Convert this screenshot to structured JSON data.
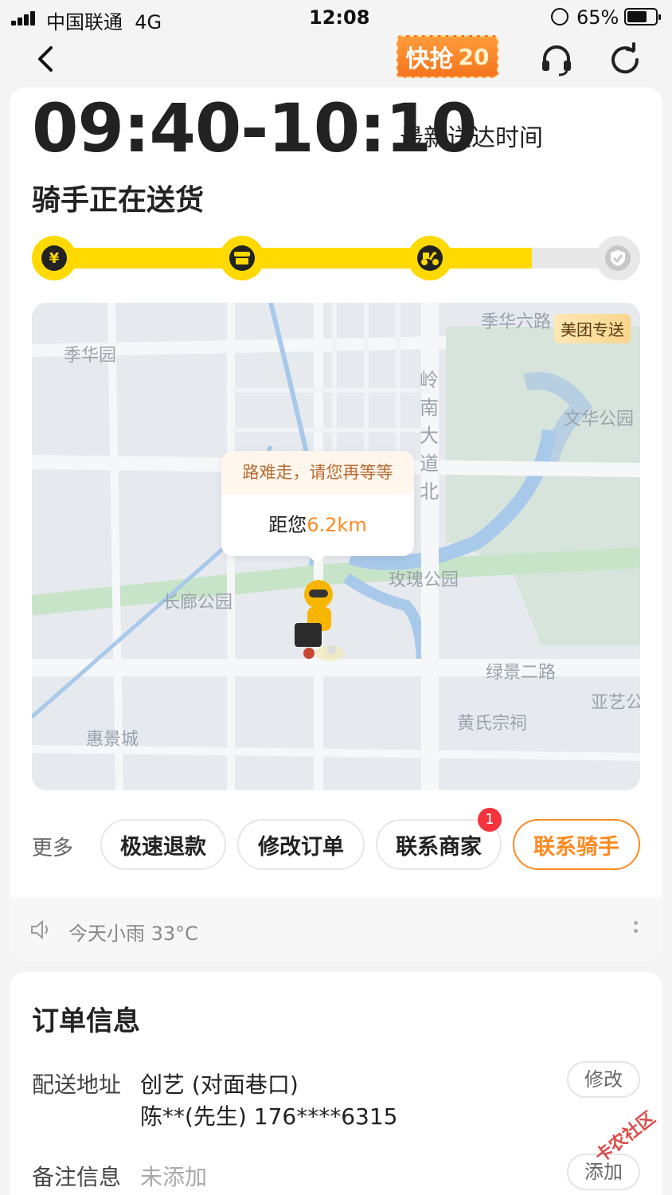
{
  "status_bar": {
    "carrier": "中国联通",
    "network": "4G",
    "time": "12:08",
    "battery_percent": "65%"
  },
  "navbar": {
    "promo_label": "快抢",
    "promo_number": "20",
    "icons": [
      "back-chevron-icon",
      "headset-icon",
      "refresh-icon"
    ]
  },
  "delivery": {
    "eta_range": "09:40-10:10",
    "eta_label": "最新送达时间",
    "status_title": "骑手正在送货",
    "progress": 0.84,
    "steps": [
      {
        "icon": "yuan-icon",
        "glyph": "¥"
      },
      {
        "icon": "store-icon",
        "glyph": ""
      },
      {
        "icon": "scooter-icon",
        "glyph": ""
      },
      {
        "icon": "shield-check-icon",
        "glyph": ""
      }
    ]
  },
  "map": {
    "badge": "美团专送",
    "bubble_message": "路难走，请您再等等",
    "distance_prefix": "距您",
    "distance_value": "6.2km",
    "labels": {
      "jihua_road": "季华六路",
      "jihua_park": "季华园",
      "wenhua_park": "文华公园",
      "meigui_park": "玫瑰公园",
      "changlang_park": "长廊公园",
      "lvjing_road": "绿景二路",
      "yayi": "亚艺公",
      "huangshi": "黄氏宗祠",
      "huijing": "惠景城",
      "lingnan_road": [
        "岭",
        "南",
        "大",
        "道",
        "北"
      ]
    }
  },
  "actions": {
    "more_label": "更多",
    "buttons": [
      "极速退款",
      "修改订单",
      "联系商家",
      "联系骑手"
    ],
    "merchant_badge": "1"
  },
  "weather": {
    "text": "今天小雨 33°C"
  },
  "order": {
    "title": "订单信息",
    "address_label": "配送地址",
    "address_line1": "创艺 (对面巷口)",
    "address_line2": "陈**(先生) 176****6315",
    "address_edit": "修改",
    "note_label": "备注信息",
    "note_value": "未添加",
    "note_action": "添加"
  },
  "watermark": "卡农社区",
  "colors": {
    "accent_yellow": "#ffd900",
    "accent_orange": "#ff8a1f",
    "badge_red": "#f5333d"
  }
}
